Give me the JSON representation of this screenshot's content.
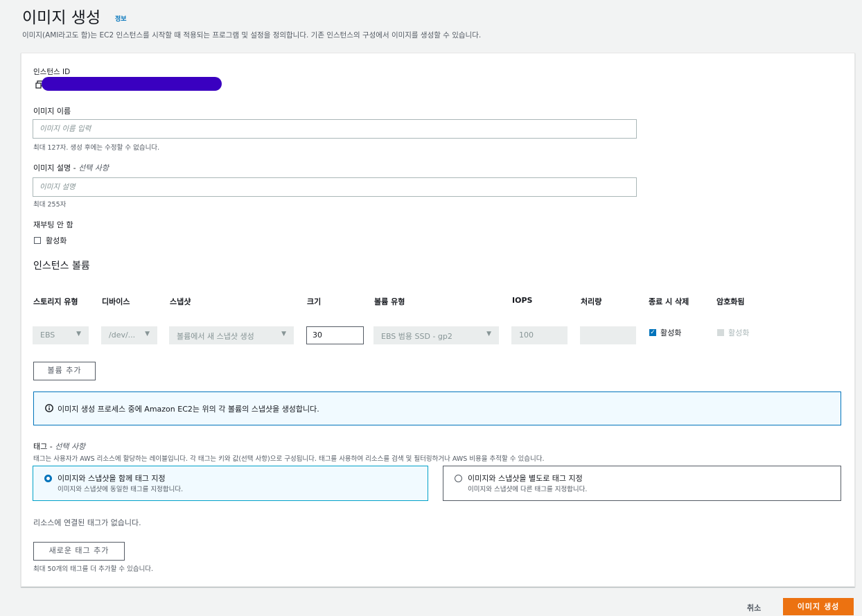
{
  "header": {
    "title": "이미지 생성",
    "info_link": "정보",
    "description": "이미지(AMI라고도 함)는 EC2 인스턴스를 시작할 때 적용되는 프로그램 및 설정을 정의합니다. 기존 인스턴스의 구성에서 이미지를 생성할 수 있습니다."
  },
  "form": {
    "instance_id_label": "인스턴스 ID",
    "instance_id_value": "",
    "image_name_label": "이미지 이름",
    "image_name_placeholder": "이미지 이름 입력",
    "image_name_hint": "최대 127자. 생성 후에는 수정할 수 없습니다.",
    "image_desc_label": "이미지 설명 - ",
    "image_desc_optional": "선택 사항",
    "image_desc_placeholder": "이미지 설명",
    "image_desc_hint": "최대 255자",
    "no_reboot_label": "재부팅 안 함",
    "no_reboot_checkbox_label": "활성화",
    "no_reboot_checked": false
  },
  "volumes": {
    "section_title": "인스턴스 볼륨",
    "columns": [
      "스토리지 유형",
      "디바이스",
      "스냅샷",
      "크기",
      "볼륨 유형",
      "IOPS",
      "처리량",
      "종료 시 삭제",
      "암호화됨"
    ],
    "row": {
      "storage_type": "EBS",
      "device": "/dev/...",
      "snapshot": "볼륨에서 새 스냅샷 생성",
      "size": "30",
      "volume_type": "EBS 범용 SSD - gp2",
      "iops": "100",
      "throughput": "",
      "delete_on_termination_label": "활성화",
      "delete_on_termination": true,
      "encrypted_label": "활성화",
      "encrypted": false
    },
    "add_volume_button": "볼륨 추가"
  },
  "alert": {
    "text": "이미지 생성 프로세스 중에 Amazon EC2는 위의 각 볼륨의 스냅샷을 생성합니다."
  },
  "tags": {
    "title": "태그 - ",
    "title_optional": "선택 사항",
    "description": "태그는 사용자가 AWS 리소스에 할당하는 레이블입니다. 각 태그는 키와 값(선택 사항)으로 구성됩니다. 태그를 사용하여 리소스를 검색 및 필터링하거나 AWS 비용을 추적할 수 있습니다.",
    "option_together_title": "이미지와 스냅샷을 함께 태그 지정",
    "option_together_desc": "이미지와 스냅샷에 동일한 태그를 지정합니다.",
    "option_separate_title": "이미지와 스냅샷을 별도로 태그 지정",
    "option_separate_desc": "이미지와 스냅샷에 다른 태그를 지정합니다.",
    "selected_option": "together",
    "no_tags_text": "리소스에 연결된 태그가 없습니다.",
    "add_tag_button": "새로운 태그 추가",
    "add_tag_hint": "최대 50개의 태그를 더 추가할 수 있습니다."
  },
  "footer": {
    "cancel": "취소",
    "submit": "이미지 생성"
  },
  "colors": {
    "primary": "#ec7211",
    "link": "#0073bb",
    "redaction": "#3a00c0"
  },
  "icons": [
    "copy-icon",
    "info-icon",
    "caret-down-icon",
    "check-icon"
  ]
}
